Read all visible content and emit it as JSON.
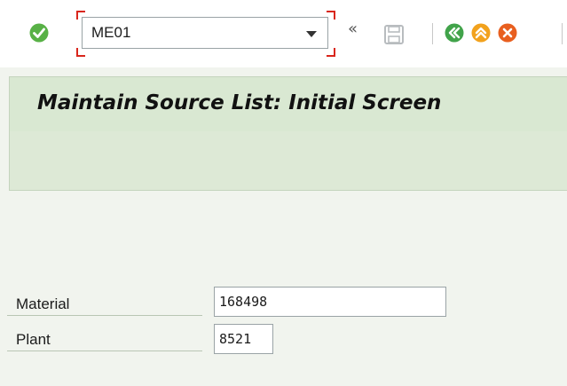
{
  "toolbar": {
    "command_field": {
      "value": "ME01"
    },
    "nav_chevrons": "«"
  },
  "title_bar": {
    "title": "Maintain Source List: Initial Screen"
  },
  "form": {
    "material": {
      "label": "Material",
      "value": "168498"
    },
    "plant": {
      "label": "Plant",
      "value": "8521"
    }
  },
  "colors": {
    "enter_green": "#58b146",
    "back_green": "#41a34a",
    "exit_orange": "#f2a21d",
    "cancel_red": "#e85f1f",
    "command_focus_red": "#d9261c"
  }
}
